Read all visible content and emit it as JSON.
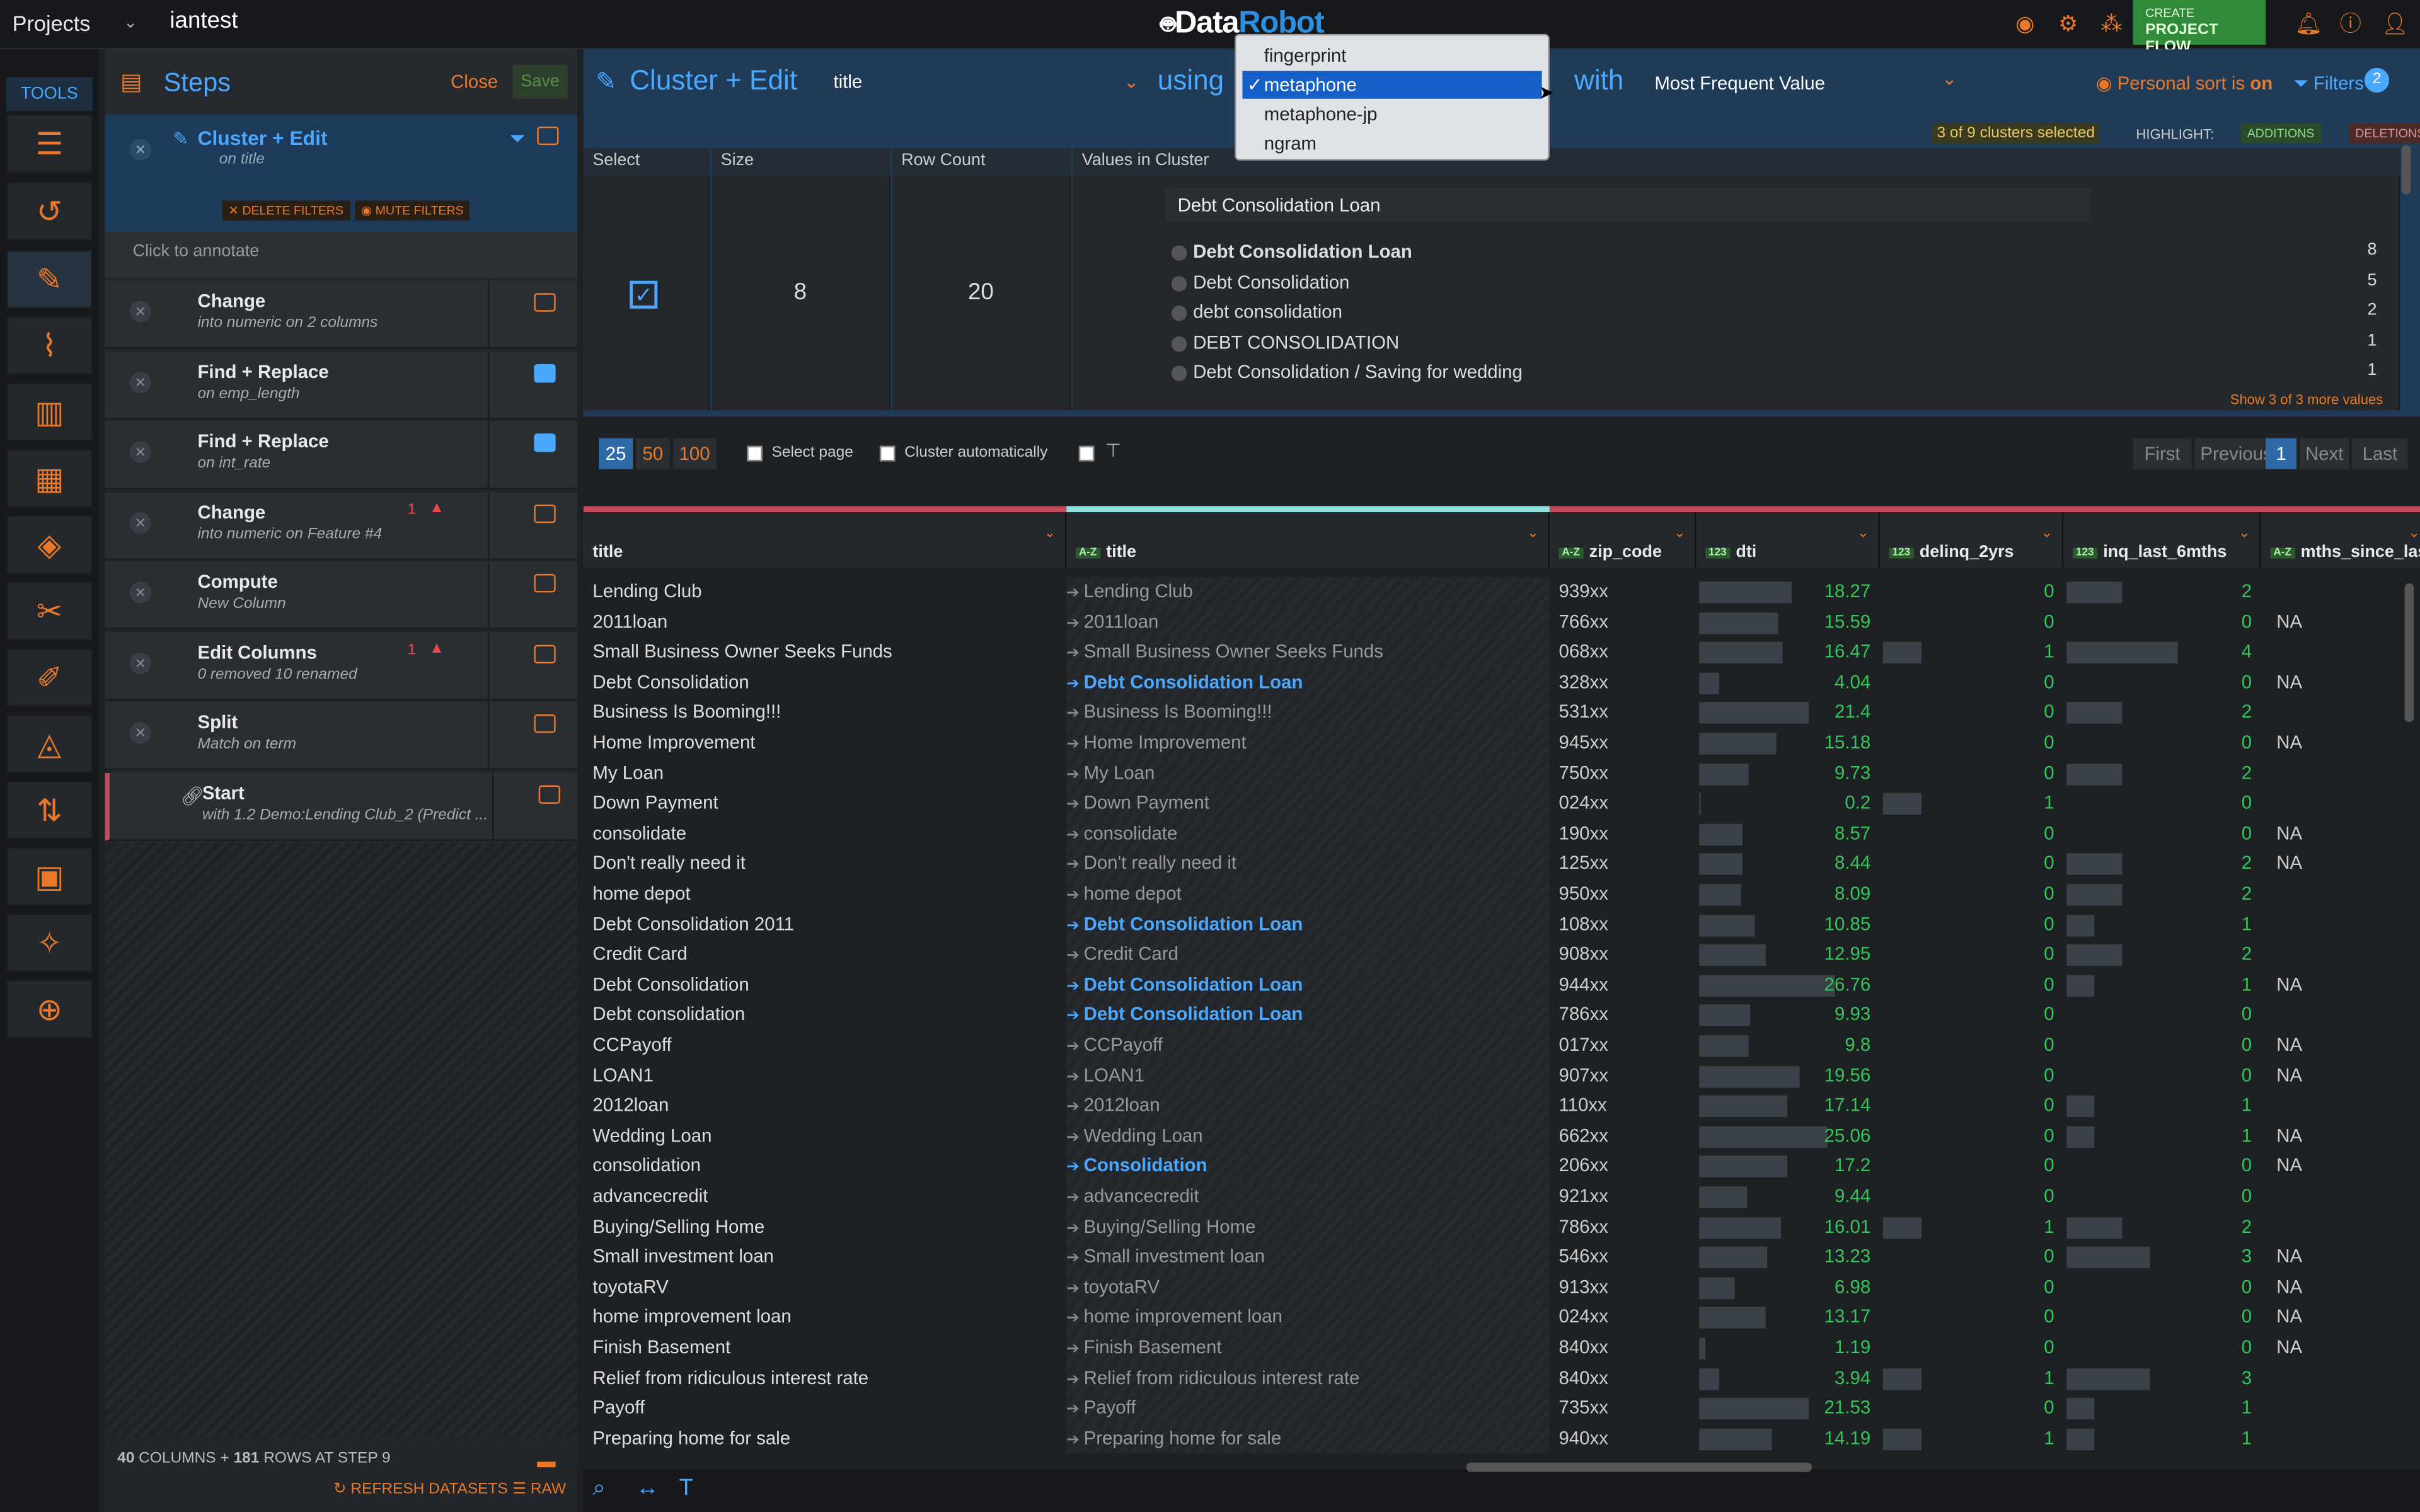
{
  "topbar": {
    "projects": "Projects",
    "project_name": "iantest",
    "logo_a": "Data",
    "logo_b": "Robot",
    "create_label": "CREATE",
    "project_flow_label": "PROJECT FLOW"
  },
  "tools": {
    "header": "TOOLS"
  },
  "steps": {
    "title": "Steps",
    "close": "Close",
    "save": "Save",
    "active": {
      "title": "Cluster + Edit",
      "sub_prefix": "on",
      "sub_field": "title",
      "delete_filters": "DELETE FILTERS",
      "mute_filters": "MUTE FILTERS",
      "annotate": "Click to annotate"
    },
    "items": [
      {
        "title": "Change",
        "sub": "into numeric on 2 columns"
      },
      {
        "title": "Find + Replace",
        "sub": "on emp_length"
      },
      {
        "title": "Find + Replace",
        "sub": "on int_rate"
      },
      {
        "title": "Change",
        "sub": "into numeric on Feature #4",
        "warn": "1"
      },
      {
        "title": "Compute",
        "sub": "New Column"
      },
      {
        "title": "Edit Columns",
        "sub": "0 removed 10 renamed",
        "warn": "1"
      },
      {
        "title": "Split",
        "sub": "Match on term"
      },
      {
        "title": "Start",
        "sub": "with 1.2 Demo:Lending Club_2 (Predict ..."
      }
    ],
    "footer": {
      "columns": "40",
      "columns_label": "COLUMNS +",
      "rows": "181",
      "rows_label": "ROWS AT STEP 9",
      "refresh": "REFRESH DATASETS",
      "raw": "RAW"
    }
  },
  "cluster": {
    "title": "Cluster + Edit",
    "field": "title",
    "using": "using",
    "with": "with",
    "method": "Most Frequent Value",
    "personal_sort": "Personal sort is",
    "personal_sort_state": "on",
    "filters": "Filters",
    "filters_count": "2",
    "method_options": [
      {
        "label": "fingerprint",
        "selected": false
      },
      {
        "label": "metaphone",
        "selected": true
      },
      {
        "label": "metaphone-jp",
        "selected": false
      },
      {
        "label": "ngram",
        "selected": false
      }
    ],
    "selected_info": "3 of 9 clusters selected",
    "highlight": "HIGHLIGHT:",
    "additions": "ADDITIONS",
    "deletions": "DELETIONS",
    "headers": [
      "Select",
      "Size",
      "Row Count",
      "Values in Cluster"
    ],
    "row": {
      "size": "8",
      "row_count": "20",
      "edit_value": "Debt Consolidation Loan",
      "values": [
        {
          "v": "Debt Consolidation Loan",
          "n": "8"
        },
        {
          "v": "Debt Consolidation",
          "n": "5"
        },
        {
          "v": "debt consolidation",
          "n": "2"
        },
        {
          "v": "DEBT CONSOLIDATION",
          "n": "1"
        },
        {
          "v": "Debt Consolidation / Saving for wedding",
          "n": "1"
        }
      ],
      "more": "Show 3 of 3 more values"
    }
  },
  "pager": {
    "sizes": [
      "25",
      "50",
      "100"
    ],
    "select_page": "Select page",
    "cluster_auto": "Cluster automatically",
    "first": "First",
    "previous": "Previous",
    "page": "1",
    "next": "Next",
    "last": "Last"
  },
  "table": {
    "columns": [
      {
        "name": "title",
        "type": ""
      },
      {
        "name": "title",
        "type": "A-Z"
      },
      {
        "name": "zip_code",
        "type": "A-Z"
      },
      {
        "name": "dti",
        "type": "123"
      },
      {
        "name": "delinq_2yrs",
        "type": "123"
      },
      {
        "name": "inq_last_6mths",
        "type": "123"
      },
      {
        "name": "mths_since_las",
        "type": "A-Z"
      }
    ],
    "rows": [
      [
        "Lending Club",
        "Lending Club",
        "939xx",
        "18.27",
        "0",
        "2",
        ""
      ],
      [
        "2011loan",
        "2011loan",
        "766xx",
        "15.59",
        "0",
        "0",
        "NA"
      ],
      [
        "Small Business Owner Seeks Funds",
        "Small Business Owner Seeks Funds",
        "068xx",
        "16.47",
        "1",
        "4",
        ""
      ],
      [
        "Debt Consolidation",
        "Debt Consolidation Loan",
        "328xx",
        "4.04",
        "0",
        "0",
        "NA"
      ],
      [
        "Business Is Booming!!!",
        "Business Is Booming!!!",
        "531xx",
        "21.4",
        "0",
        "2",
        ""
      ],
      [
        "Home Improvement",
        "Home Improvement",
        "945xx",
        "15.18",
        "0",
        "0",
        "NA"
      ],
      [
        "My Loan",
        "My Loan",
        "750xx",
        "9.73",
        "0",
        "2",
        ""
      ],
      [
        "Down Payment",
        "Down Payment",
        "024xx",
        "0.2",
        "1",
        "0",
        ""
      ],
      [
        "consolidate",
        "consolidate",
        "190xx",
        "8.57",
        "0",
        "0",
        "NA"
      ],
      [
        "Don't really need it",
        "Don't really need it",
        "125xx",
        "8.44",
        "0",
        "2",
        "NA"
      ],
      [
        "home depot",
        "home depot",
        "950xx",
        "8.09",
        "0",
        "2",
        ""
      ],
      [
        "Debt Consolidation 2011",
        "Debt Consolidation Loan",
        "108xx",
        "10.85",
        "0",
        "1",
        ""
      ],
      [
        "Credit Card",
        "Credit Card",
        "908xx",
        "12.95",
        "0",
        "2",
        ""
      ],
      [
        "Debt Consolidation",
        "Debt Consolidation Loan",
        "944xx",
        "26.76",
        "0",
        "1",
        "NA"
      ],
      [
        "Debt consolidation",
        "Debt Consolidation Loan",
        "786xx",
        "9.93",
        "0",
        "0",
        ""
      ],
      [
        "CCPayoff",
        "CCPayoff",
        "017xx",
        "9.8",
        "0",
        "0",
        "NA"
      ],
      [
        "LOAN1",
        "LOAN1",
        "907xx",
        "19.56",
        "0",
        "0",
        "NA"
      ],
      [
        "2012loan",
        "2012loan",
        "110xx",
        "17.14",
        "0",
        "1",
        ""
      ],
      [
        "Wedding Loan",
        "Wedding Loan",
        "662xx",
        "25.06",
        "0",
        "1",
        "NA"
      ],
      [
        "consolidation",
        "Consolidation",
        "206xx",
        "17.2",
        "0",
        "0",
        "NA"
      ],
      [
        "advancecredit",
        "advancecredit",
        "921xx",
        "9.44",
        "0",
        "0",
        ""
      ],
      [
        "Buying/Selling Home",
        "Buying/Selling Home",
        "786xx",
        "16.01",
        "1",
        "2",
        ""
      ],
      [
        "Small investment loan",
        "Small investment loan",
        "546xx",
        "13.23",
        "0",
        "3",
        "NA"
      ],
      [
        "toyotaRV",
        "toyotaRV",
        "913xx",
        "6.98",
        "0",
        "0",
        "NA"
      ],
      [
        "home improvement loan",
        "home improvement loan",
        "024xx",
        "13.17",
        "0",
        "0",
        "NA"
      ],
      [
        "Finish Basement",
        "Finish Basement",
        "840xx",
        "1.19",
        "0",
        "0",
        "NA"
      ],
      [
        "Relief from ridiculous interest rate",
        "Relief from ridiculous interest rate",
        "840xx",
        "3.94",
        "1",
        "3",
        ""
      ],
      [
        "Payoff",
        "Payoff",
        "735xx",
        "21.53",
        "0",
        "1",
        ""
      ],
      [
        "Preparing home for sale",
        "Preparing home for sale",
        "940xx",
        "14.19",
        "1",
        "1",
        ""
      ]
    ],
    "changed_rows": [
      3,
      11,
      13,
      14,
      19
    ]
  },
  "colors": {
    "accent": "#e8792a",
    "blue": "#4aa8ff",
    "green": "#34c45a"
  }
}
